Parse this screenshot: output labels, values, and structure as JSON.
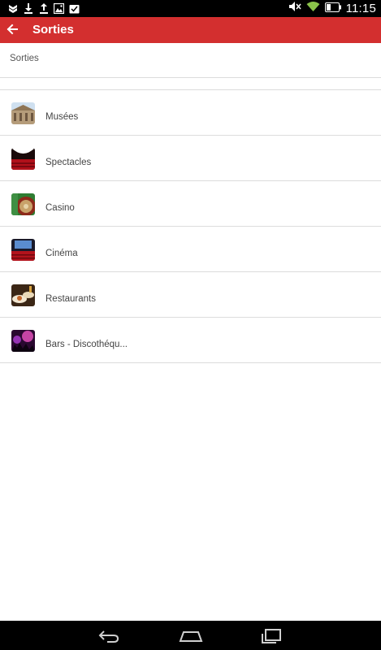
{
  "status_bar": {
    "time": "11:15",
    "left_icons": [
      "notification-icon",
      "download-icon",
      "upload-icon",
      "image-icon",
      "task-icon"
    ],
    "right_icons": [
      "mute-icon",
      "wifi-icon",
      "battery-icon"
    ]
  },
  "app_bar": {
    "title": "Sorties",
    "color": "#d32f2f"
  },
  "subheader": {
    "text": "Sorties"
  },
  "list": {
    "items": [
      {
        "label": "Musées",
        "icon": "museum-thumbnail"
      },
      {
        "label": "Spectacles",
        "icon": "theatre-thumbnail"
      },
      {
        "label": "Casino",
        "icon": "roulette-thumbnail"
      },
      {
        "label": "Cinéma",
        "icon": "cinema-thumbnail"
      },
      {
        "label": "Restaurants",
        "icon": "restaurant-thumbnail"
      },
      {
        "label": "Bars - Discothéqu...",
        "icon": "nightclub-thumbnail"
      }
    ]
  },
  "nav_bar": {
    "buttons": [
      "back-icon",
      "home-icon",
      "recent-apps-icon"
    ]
  }
}
